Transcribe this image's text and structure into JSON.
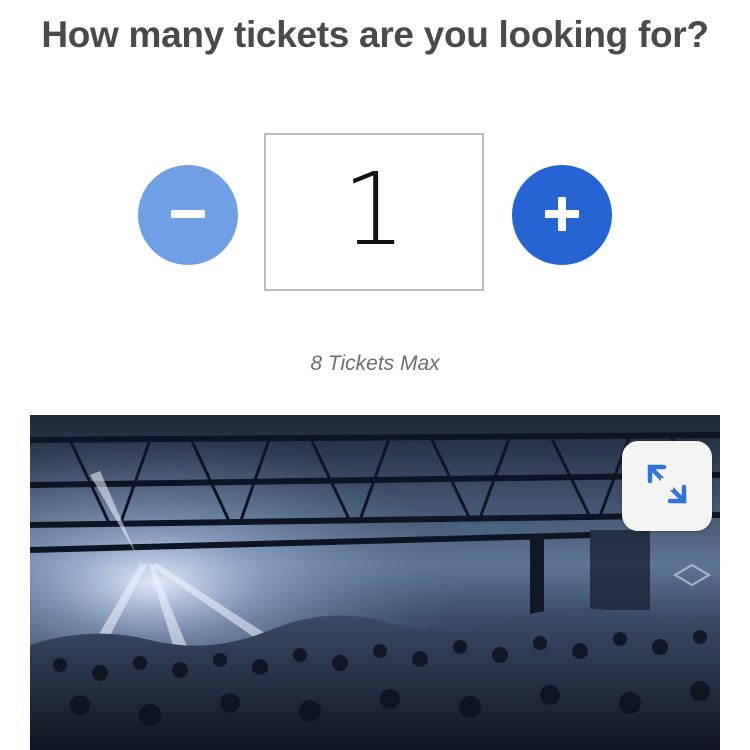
{
  "heading": "How many tickets are you looking for?",
  "quantity": {
    "value": "1",
    "decrement_icon": "minus-icon",
    "increment_icon": "plus-icon"
  },
  "max_note": "8 Tickets Max",
  "venue_image": {
    "description_icon": "concert-venue-photo",
    "expand_icon": "expand-diagonal-icon"
  },
  "colors": {
    "decrement_button": "#6f9fe4",
    "increment_button": "#2764d3",
    "heading_text": "#4a4a4a",
    "note_text": "#6d6d6d",
    "expand_arrow": "#2f74d8"
  }
}
